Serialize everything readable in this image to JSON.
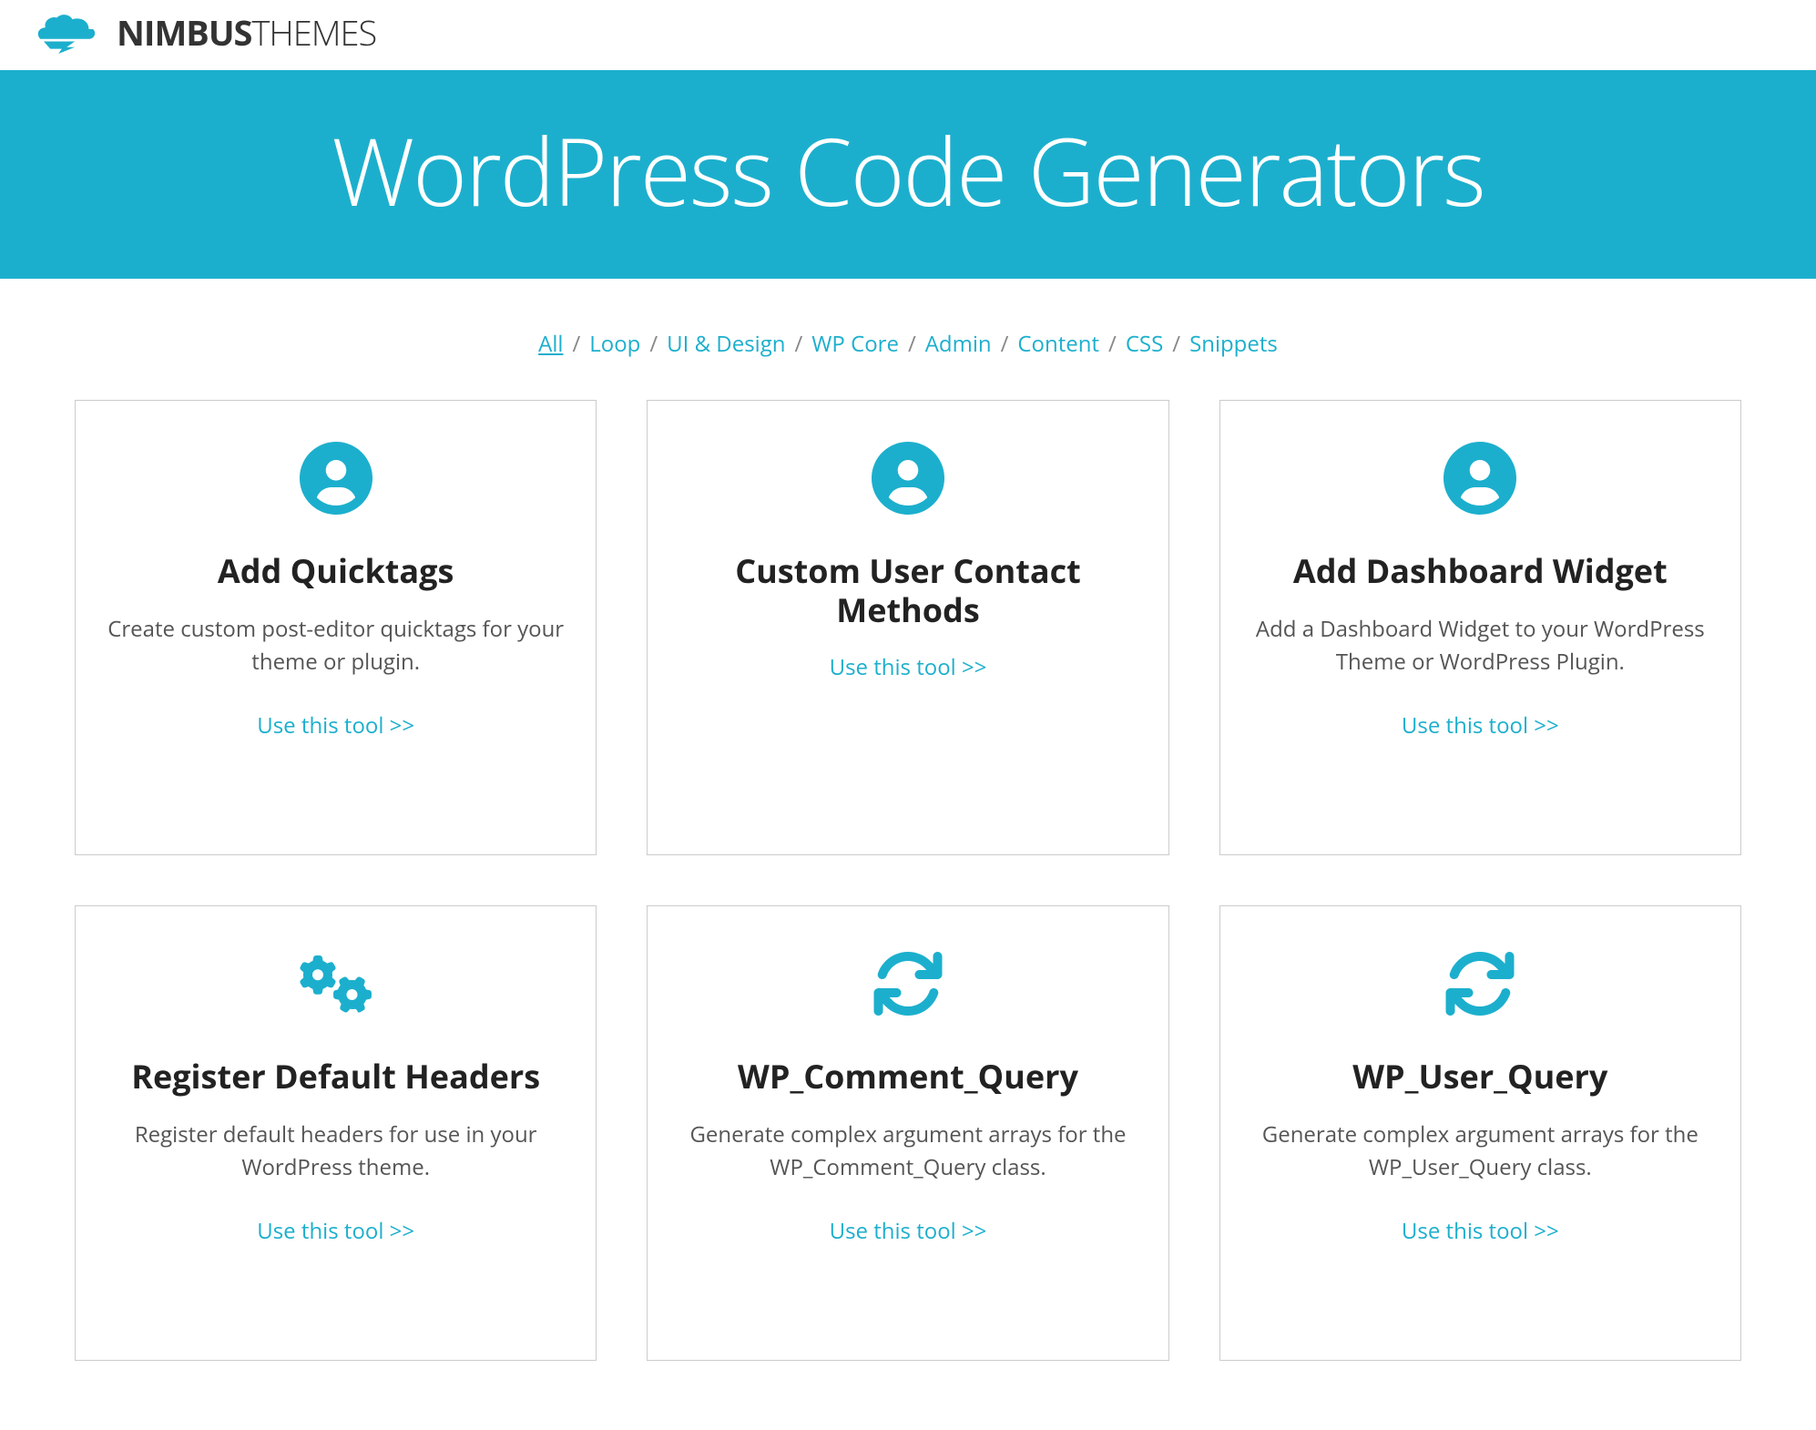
{
  "logo": {
    "text_bold": "NIMBUS",
    "text_light": "THEMES"
  },
  "hero": {
    "title": "WordPress Code Generators"
  },
  "filters": [
    {
      "label": "All",
      "active": true
    },
    {
      "label": "Loop",
      "active": false
    },
    {
      "label": "UI & Design",
      "active": false
    },
    {
      "label": "WP Core",
      "active": false
    },
    {
      "label": "Admin",
      "active": false
    },
    {
      "label": "Content",
      "active": false
    },
    {
      "label": "CSS",
      "active": false
    },
    {
      "label": "Snippets",
      "active": false
    }
  ],
  "cards": [
    {
      "icon": "user-icon",
      "title": "Add Quicktags",
      "desc": "Create custom post-editor quicktags for your theme or plugin.",
      "link_label": "Use this tool >>"
    },
    {
      "icon": "user-icon",
      "title": "Custom User Contact Methods",
      "desc": "",
      "link_label": "Use this tool >>"
    },
    {
      "icon": "user-icon",
      "title": "Add Dashboard Widget",
      "desc": "Add a Dashboard Widget to your WordPress Theme or WordPress Plugin.",
      "link_label": "Use this tool >>"
    },
    {
      "icon": "gears-icon",
      "title": "Register Default Headers",
      "desc": "Register default headers for use in your WordPress theme.",
      "link_label": "Use this tool >>"
    },
    {
      "icon": "refresh-icon",
      "title": "WP_Comment_Query",
      "desc": "Generate complex argument arrays for the WP_Comment_Query class.",
      "link_label": "Use this tool >>"
    },
    {
      "icon": "refresh-icon",
      "title": "WP_User_Query",
      "desc": "Generate complex argument arrays for the WP_User_Query class.",
      "link_label": "Use this tool >>"
    }
  ],
  "colors": {
    "accent": "#1cafcd"
  }
}
